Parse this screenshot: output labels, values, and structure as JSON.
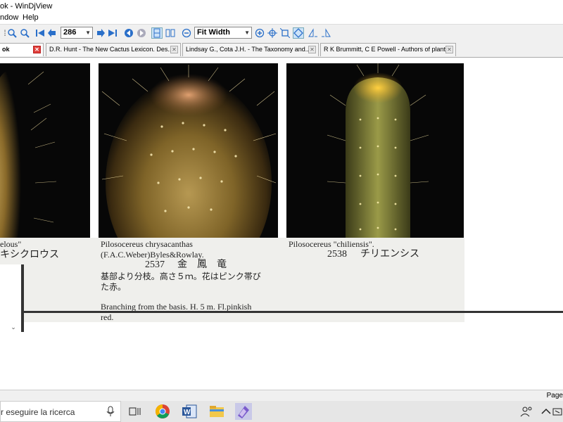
{
  "window": {
    "title": "ok  - WinDjView"
  },
  "menu": {
    "items": [
      "ndow",
      "Help"
    ]
  },
  "toolbar": {
    "page_number": "286",
    "zoom": "Fit Width"
  },
  "tabs": [
    {
      "label": "ok",
      "active": true
    },
    {
      "label": "D.R. Hunt - The New Cactus Lexicon. Des...",
      "active": false
    },
    {
      "label": "Lindsay G., Cota J.H. - The Taxonomy and...",
      "active": false
    },
    {
      "label": "R K Brummitt, C E Powell - Authors of plant...",
      "active": false
    }
  ],
  "page": {
    "left": {
      "name_fragment": "elous\"",
      "katakana": "キシクロウス"
    },
    "middle": {
      "latin_line1": "Pilosocereus chrysacanthas",
      "latin_line2": "(F.A.C.Weber)Byles&Rowlay.",
      "number": "2537",
      "kanji": "金　鳳　竜",
      "jp_desc_line1": "基部より分枝。高さ５ｍ。花はピンク帯び",
      "jp_desc_line2": "た赤。",
      "en_desc_line1": "Branching from the basis. H. 5 m. Fl.pinkish",
      "en_desc_line2": "red."
    },
    "right": {
      "latin": "Pilosocereus \"chiliensis\".",
      "number": "2538",
      "katakana": "チリエンシス"
    }
  },
  "statusbar": {
    "text": "Page"
  },
  "taskbar": {
    "search_text": "r eseguire la ricerca"
  }
}
